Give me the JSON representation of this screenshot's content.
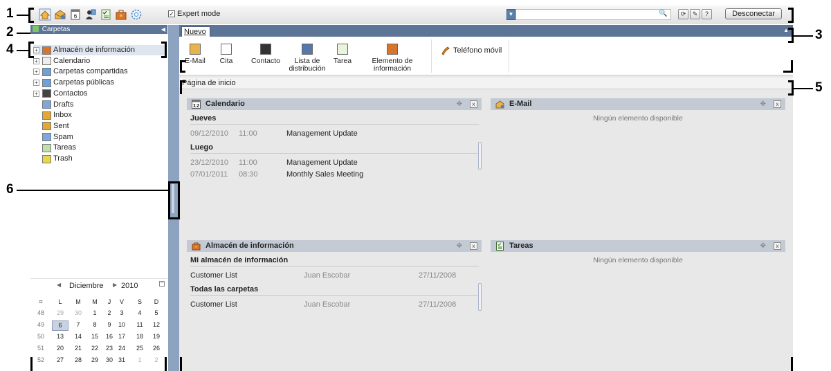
{
  "toolbar": {
    "icons": [
      "home-icon",
      "mail-icon",
      "calendar-icon",
      "contacts-icon",
      "tasks-icon",
      "briefcase-icon",
      "settings-icon"
    ],
    "expert_mode_label": "Expert mode",
    "expert_mode_checked": true,
    "search_value": "",
    "logout_label": "Desconectar"
  },
  "sidebar": {
    "header": "Carpetas",
    "items": [
      {
        "label": "Almacén de información",
        "icon": "briefcase-icon",
        "expandable": true,
        "selected": true
      },
      {
        "label": "Calendario",
        "icon": "calendar-icon",
        "expandable": true
      },
      {
        "label": "Carpetas compartidas",
        "icon": "shared-folder-icon",
        "expandable": true
      },
      {
        "label": "Carpetas públicas",
        "icon": "public-folder-icon",
        "expandable": true
      },
      {
        "label": "Contactos",
        "icon": "contacts-icon",
        "expandable": true
      },
      {
        "label": "Drafts",
        "icon": "drafts-icon",
        "expandable": false
      },
      {
        "label": "Inbox",
        "icon": "inbox-icon",
        "expandable": false
      },
      {
        "label": "Sent",
        "icon": "sent-icon",
        "expandable": false
      },
      {
        "label": "Spam",
        "icon": "spam-icon",
        "expandable": false
      },
      {
        "label": "Tareas",
        "icon": "tasks-icon",
        "expandable": false
      },
      {
        "label": "Trash",
        "icon": "trash-icon",
        "expandable": false
      }
    ]
  },
  "minical": {
    "month": "Diciembre",
    "year": "2010",
    "day_headers": [
      "L",
      "M",
      "M",
      "J",
      "V",
      "S",
      "D"
    ],
    "weeks": [
      {
        "wk": "48",
        "days": [
          "29",
          "30",
          "1",
          "2",
          "3",
          "4",
          "5"
        ]
      },
      {
        "wk": "49",
        "days": [
          "6",
          "7",
          "8",
          "9",
          "10",
          "11",
          "12"
        ]
      },
      {
        "wk": "50",
        "days": [
          "13",
          "14",
          "15",
          "16",
          "17",
          "18",
          "19"
        ]
      },
      {
        "wk": "51",
        "days": [
          "20",
          "21",
          "22",
          "23",
          "24",
          "25",
          "26"
        ]
      },
      {
        "wk": "52",
        "days": [
          "27",
          "28",
          "29",
          "30",
          "31",
          "1",
          "2"
        ]
      }
    ],
    "today": "6"
  },
  "new_panel": {
    "tab_label": "Nuevo",
    "items": [
      {
        "label": "E-Mail",
        "icon": "mail-icon"
      },
      {
        "label": "Cita",
        "icon": "calendar-icon"
      },
      {
        "label": "Contacto",
        "icon": "contact-icon"
      },
      {
        "label": "Lista de distribución",
        "icon": "distribution-list-icon"
      },
      {
        "label": "Tarea",
        "icon": "task-icon"
      },
      {
        "label": "Elemento de información",
        "icon": "briefcase-icon"
      }
    ],
    "phone_label": "Teléfono móvil"
  },
  "home": {
    "title": "Página de inicio",
    "calendar_widget": {
      "title": "Calendario",
      "sections": [
        {
          "heading": "Jueves",
          "rows": [
            {
              "date": "09/12/2010",
              "time": "11:00",
              "subject": "Management Update"
            }
          ]
        },
        {
          "heading": "Luego",
          "rows": [
            {
              "date": "23/12/2010",
              "time": "11:00",
              "subject": "Management Update"
            },
            {
              "date": "07/01/2011",
              "time": "08:30",
              "subject": "Monthly Sales Meeting"
            }
          ]
        }
      ]
    },
    "email_widget": {
      "title": "E-Mail",
      "empty_text": "Ningún elemento disponible"
    },
    "info_widget": {
      "title": "Almacén de información",
      "sections": [
        {
          "heading": "Mi almacén de información",
          "rows": [
            {
              "name": "Customer List",
              "owner": "Juan Escobar",
              "date": "27/11/2008"
            }
          ]
        },
        {
          "heading": "Todas las carpetas",
          "rows": [
            {
              "name": "Customer List",
              "owner": "Juan Escobar",
              "date": "27/11/2008"
            }
          ]
        }
      ]
    },
    "tasks_widget": {
      "title": "Tareas",
      "empty_text": "Ningún elemento disponible"
    }
  },
  "callouts": [
    "1",
    "2",
    "3",
    "4",
    "5",
    "6"
  ],
  "colors": {
    "header_blue": "#5c7496",
    "splitter": "#8ea3c0",
    "widget_header": "#c4cad3"
  }
}
